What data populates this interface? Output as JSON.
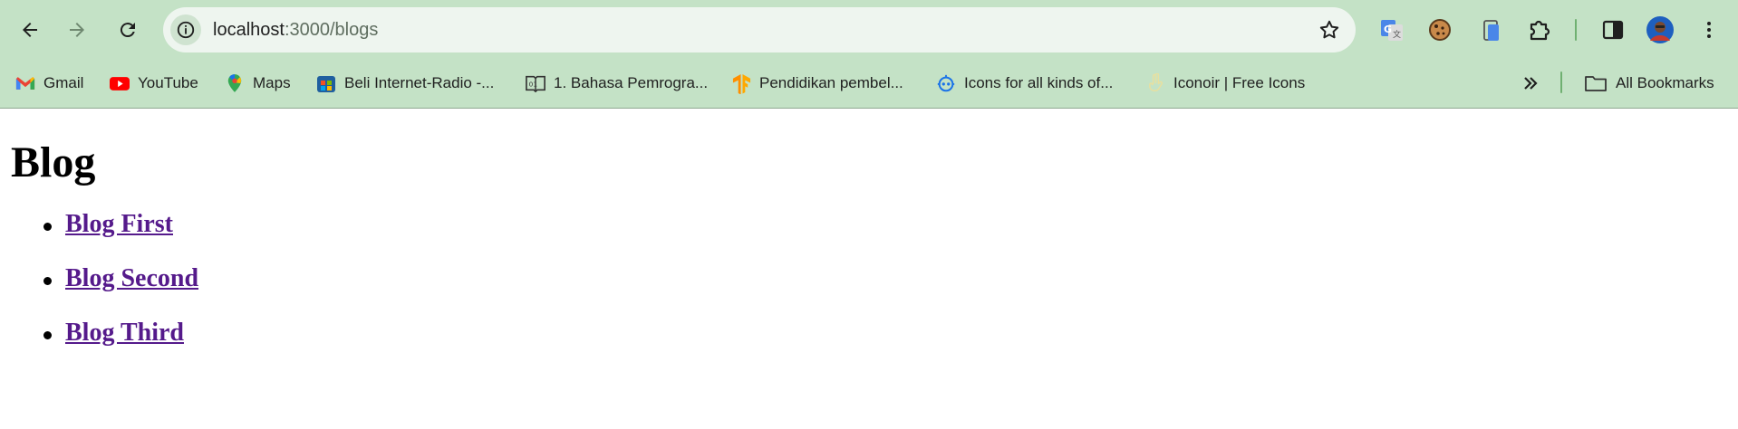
{
  "browser": {
    "url_host": "localhost",
    "url_path": ":3000/blogs",
    "accent_color": "#c4e2c6",
    "bookmarks": [
      {
        "label": "Gmail",
        "icon": "gmail-icon"
      },
      {
        "label": "YouTube",
        "icon": "youtube-icon"
      },
      {
        "label": "Maps",
        "icon": "maps-icon"
      },
      {
        "label": "Beli Internet-Radio -...",
        "icon": "radio-store-icon"
      },
      {
        "label": "1. Bahasa Pemrogra...",
        "icon": "book-icon"
      },
      {
        "label": "Pendidikan pembel...",
        "icon": "tensorflow-icon"
      },
      {
        "label": "Icons for all kinds of...",
        "icon": "robot-icon"
      },
      {
        "label": "Iconoir | Free Icons",
        "icon": "peace-hand-icon"
      }
    ],
    "all_bookmarks_label": "All Bookmarks"
  },
  "page": {
    "title": "Blog",
    "links": [
      "Blog First",
      "Blog Second",
      "Blog Third"
    ],
    "link_color": "#551a8b"
  }
}
